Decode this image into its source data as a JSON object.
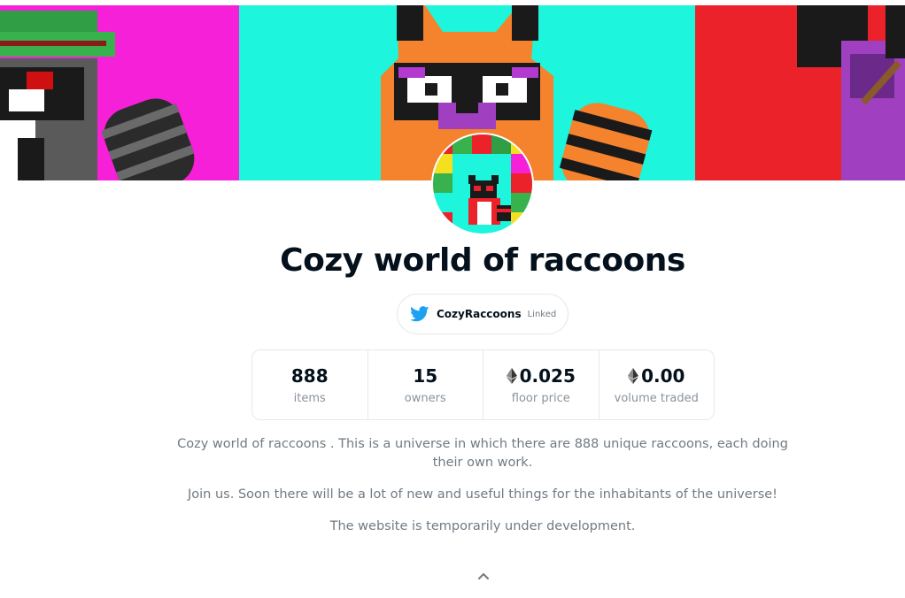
{
  "banner": {
    "panels": [
      {
        "background": "#f520d8",
        "description": "raccoon-with-green-hat"
      },
      {
        "background": "#1df5dc",
        "description": "orange-raccoon"
      },
      {
        "background": "#eb2229",
        "description": "raccoon-with-purple-hood"
      }
    ]
  },
  "avatar": {
    "background": "#1df5dc"
  },
  "collection": {
    "title": "Cozy world of raccoons"
  },
  "twitter": {
    "handle": "CozyRaccoons",
    "status": "Linked",
    "icon": "twitter-bird-icon",
    "color": "#1da1f2"
  },
  "stats": [
    {
      "value": "888",
      "label": "items",
      "eth": false
    },
    {
      "value": "15",
      "label": "owners",
      "eth": false
    },
    {
      "value": "0.025",
      "label": "floor price",
      "eth": true
    },
    {
      "value": "0.00",
      "label": "volume traded",
      "eth": true
    }
  ],
  "description": {
    "paragraphs": [
      "Cozy world of raccoons . This is a universe in which there are 888 unique raccoons, each doing their own work.",
      "Join us. Soon there will be a lot of new and useful things for the inhabitants of the universe!",
      "The website is temporarily under development."
    ]
  },
  "colors": {
    "text_primary": "#04111d",
    "text_secondary": "#707a83",
    "border": "#e5e8eb"
  }
}
